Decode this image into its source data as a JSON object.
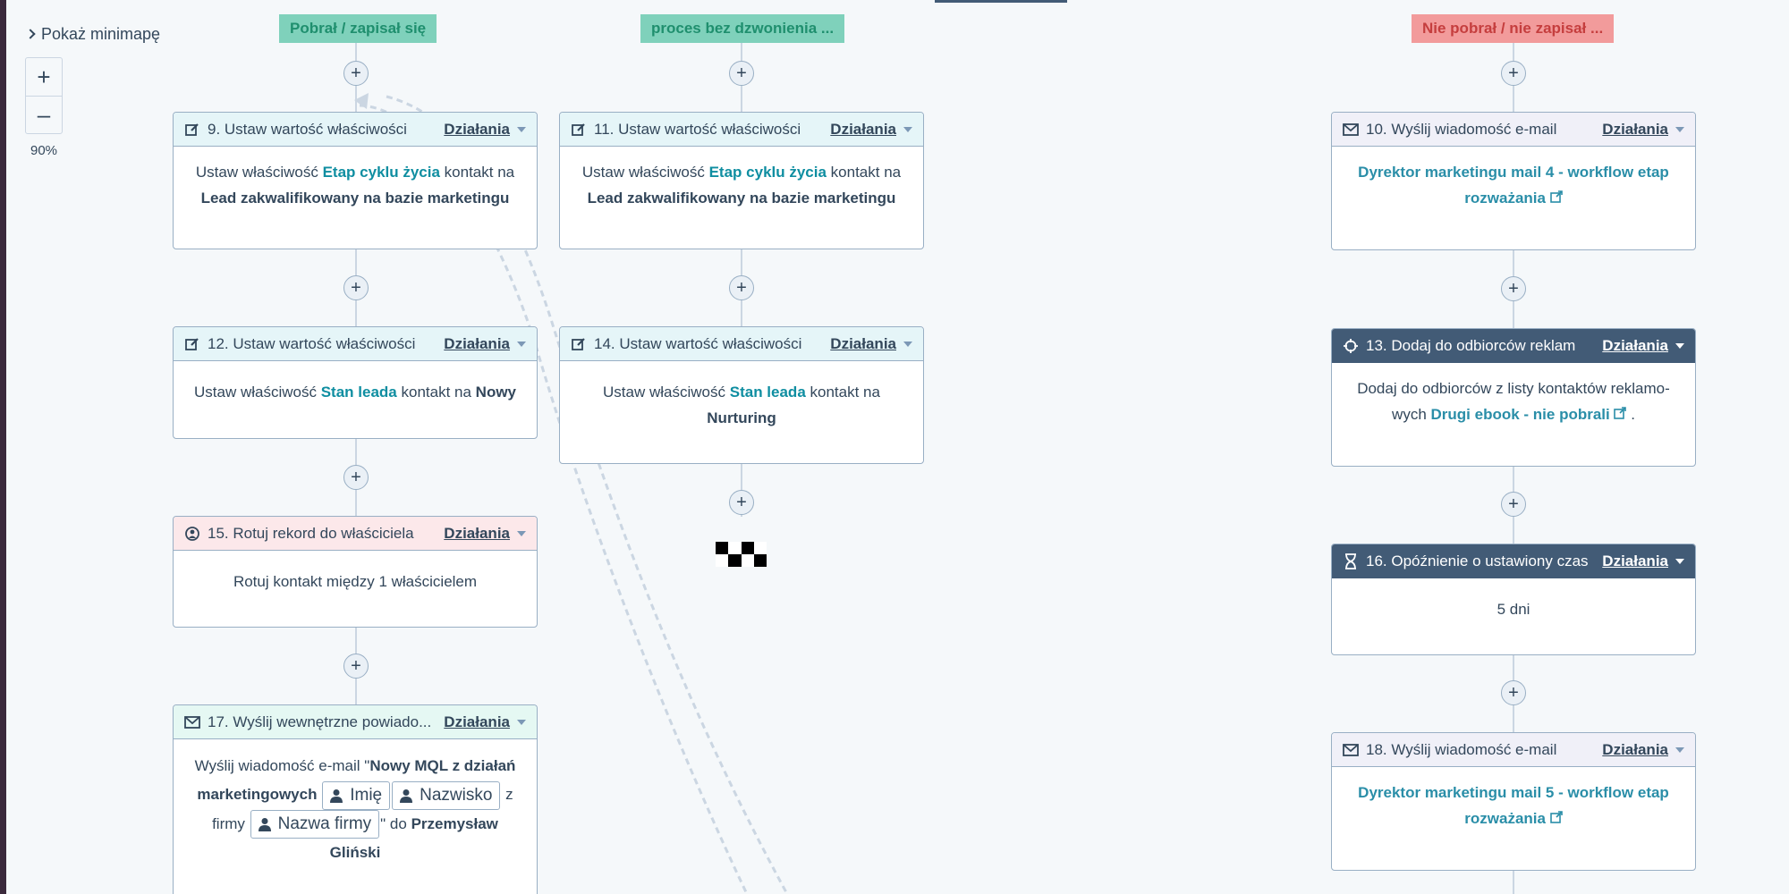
{
  "minimap": {
    "label": "Pokaż minimapę"
  },
  "zoom": {
    "in": "+",
    "out": "–",
    "level": "90%"
  },
  "branches": {
    "left": "Pobrał / zapisał się",
    "middle": "proces bez dzwonienia ...",
    "right": "Nie pobrał / nie zapisał ..."
  },
  "actions_label": "Działania",
  "plus": "+",
  "cards": {
    "c9": {
      "title": "9. Ustaw wartość właściwości",
      "pre": "Ustaw właściwość",
      "prop": "Etap cyklu życia",
      "mid": "kontakt na",
      "value": "Lead zakwalifikowany na bazie marketingu"
    },
    "c11": {
      "title": "11. Ustaw wartość właściwości",
      "pre": "Ustaw właściwość",
      "prop": "Etap cyklu życia",
      "mid": "kontakt na",
      "value": "Lead zakwalifikowany na bazie marketingu"
    },
    "c12": {
      "title": "12. Ustaw wartość właściwości",
      "pre": "Ustaw właściwość",
      "prop": "Stan leada",
      "mid": "kontakt na",
      "value": "Nowy"
    },
    "c14": {
      "title": "14. Ustaw wartość właściwości",
      "pre": "Ustaw właściwość",
      "prop": "Stan leada",
      "mid": "kontakt na",
      "value": "Nurturing"
    },
    "c15": {
      "title": "15. Rotuj rekord do właściciela",
      "body": "Rotuj kontakt między 1 właścicielem"
    },
    "c17": {
      "title": "17. Wyślij wewnętrzne powiado...",
      "pre": "Wyślij wiadomość e-mail \"",
      "subject": "Nowy MQL z działań marketingowych",
      "token1": "Imię",
      "token2": "Nazwisko",
      "z": "z firmy",
      "token3": "Nazwa firmy",
      "post": "\" do",
      "recipient": "Przemysław Gliński"
    },
    "c10": {
      "title": "10. Wyślij wiadomość e-mail",
      "link": "Dyrektor marketingu mail 4 - workflow etap rozważania"
    },
    "c13": {
      "title": "13. Dodaj do odbiorców reklam",
      "pre": "Dodaj do odbiorców z listy kontaktów reklamo-wych",
      "link": "Drugi ebook - nie pobrali",
      "post": "."
    },
    "c16": {
      "title": "16. Opóźnienie o ustawiony czas",
      "body": "5 dni"
    },
    "c18": {
      "title": "18. Wyślij wiadomość e-mail",
      "link": "Dyrektor marketingu mail 5 - workflow etap rozważania"
    }
  }
}
